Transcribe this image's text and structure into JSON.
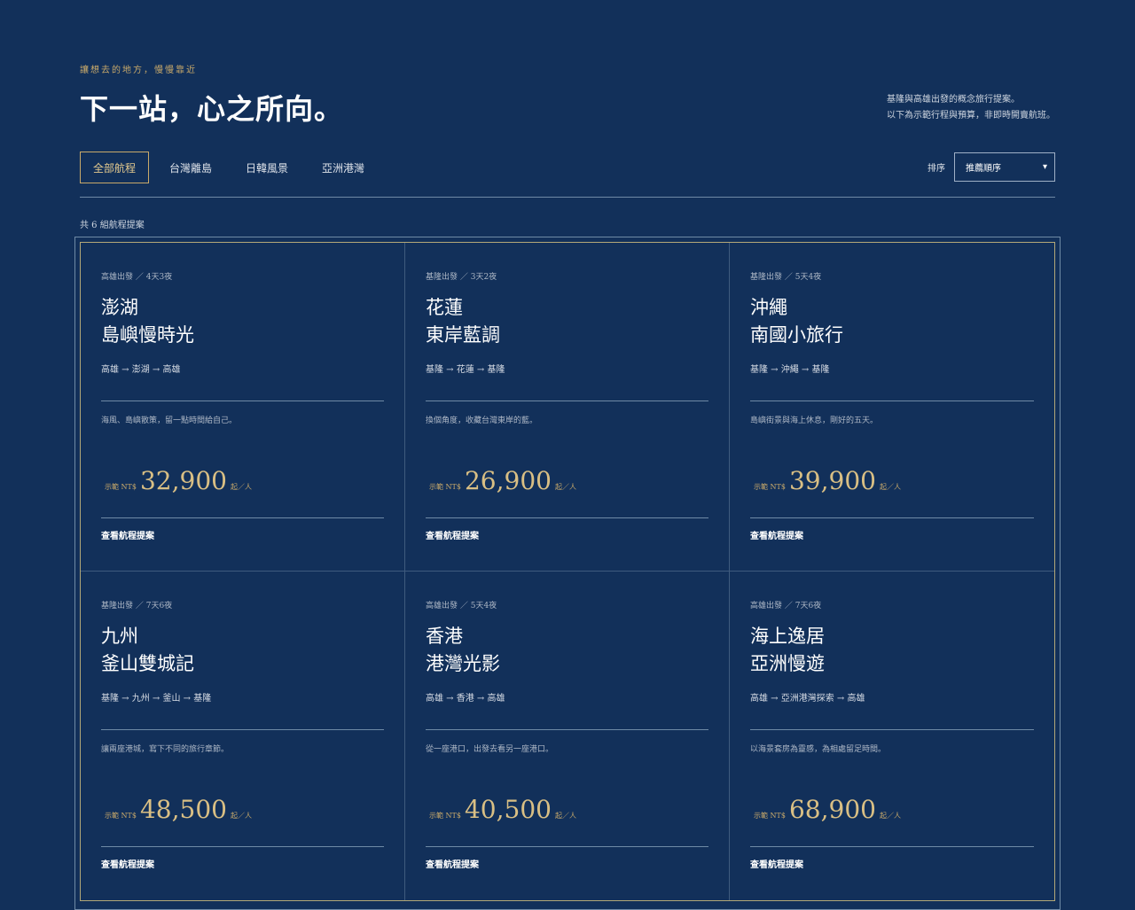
{
  "header": {
    "eyebrow": "讓想去的地方，慢慢靠近",
    "title": "下一站，心之所向。",
    "intro": [
      "基隆與高雄出發的概念旅行提案。",
      "以下為示範行程與預算，非即時開賣航班。"
    ]
  },
  "tabs": [
    {
      "label": "全部航程",
      "active": true
    },
    {
      "label": "台灣離島",
      "active": false
    },
    {
      "label": "日韓風景",
      "active": false
    },
    {
      "label": "亞洲港灣",
      "active": false
    }
  ],
  "sort": {
    "label": "排序",
    "selected": "推薦順序"
  },
  "count_text": "共 6 組航程提案",
  "cards": [
    {
      "meta": "高雄出發 ／ 4天3夜",
      "title1": "澎湖",
      "title2": "島嶼慢時光",
      "route": "高雄 → 澎湖 → 高雄",
      "desc": "海風、島嶼散策，留一點時間給自己。",
      "price_prefix": "示範 NT$",
      "price": "32,900",
      "price_unit": "起／人",
      "link": "查看航程提案"
    },
    {
      "meta": "基隆出發 ／ 3天2夜",
      "title1": "花蓮",
      "title2": "東岸藍調",
      "route": "基隆 → 花蓮 → 基隆",
      "desc": "換個角度，收藏台灣東岸的藍。",
      "price_prefix": "示範 NT$",
      "price": "26,900",
      "price_unit": "起／人",
      "link": "查看航程提案"
    },
    {
      "meta": "基隆出發 ／ 5天4夜",
      "title1": "沖繩",
      "title2": "南國小旅行",
      "route": "基隆 → 沖繩 → 基隆",
      "desc": "島嶼街景與海上休息，剛好的五天。",
      "price_prefix": "示範 NT$",
      "price": "39,900",
      "price_unit": "起／人",
      "link": "查看航程提案"
    },
    {
      "meta": "基隆出發 ／ 7天6夜",
      "title1": "九州",
      "title2": "釜山雙城記",
      "route": "基隆 → 九州 → 釜山 → 基隆",
      "desc": "讓兩座港城，寫下不同的旅行章節。",
      "price_prefix": "示範 NT$",
      "price": "48,500",
      "price_unit": "起／人",
      "link": "查看航程提案"
    },
    {
      "meta": "高雄出發 ／ 5天4夜",
      "title1": "香港",
      "title2": "港灣光影",
      "route": "高雄 → 香港 → 高雄",
      "desc": "從一座港口，出發去看另一座港口。",
      "price_prefix": "示範 NT$",
      "price": "40,500",
      "price_unit": "起／人",
      "link": "查看航程提案"
    },
    {
      "meta": "高雄出發 ／ 7天6夜",
      "title1": "海上逸居",
      "title2": "亞洲慢遊",
      "route": "高雄 → 亞洲港灣探索 → 高雄",
      "desc": "以海景套房為靈感，為相處留足時間。",
      "price_prefix": "示範 NT$",
      "price": "68,900",
      "price_unit": "起／人",
      "link": "查看航程提案"
    }
  ]
}
